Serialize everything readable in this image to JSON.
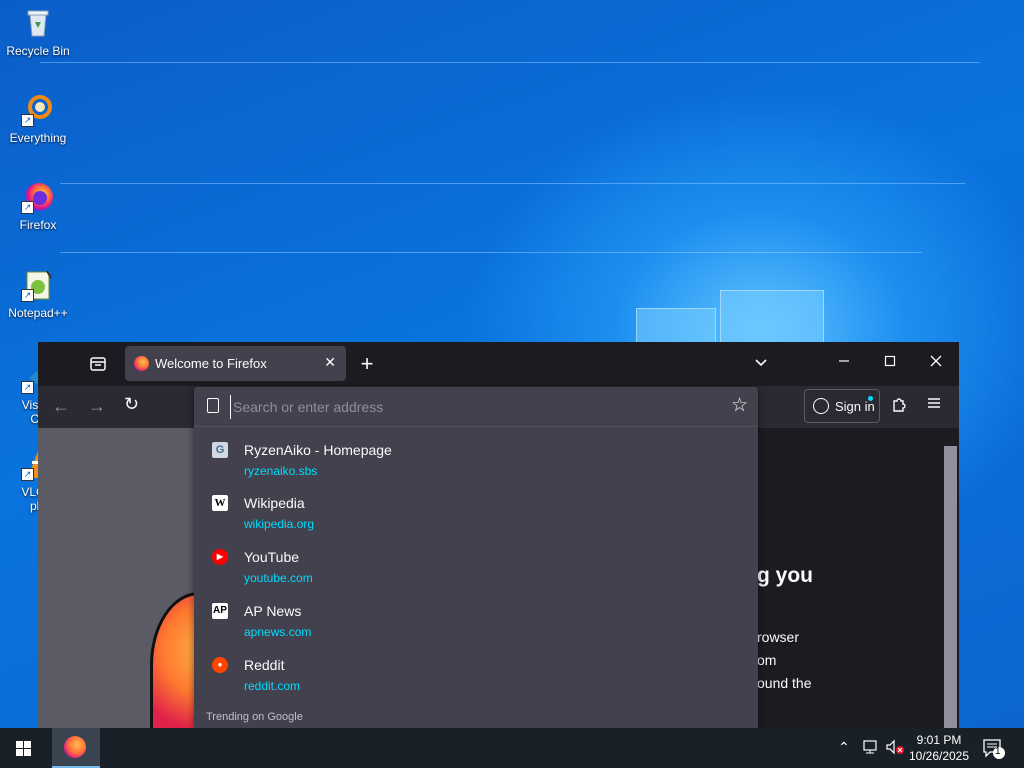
{
  "desktop": {
    "icons": [
      {
        "label": "Recycle Bin"
      },
      {
        "label": "Everything"
      },
      {
        "label": "Firefox"
      },
      {
        "label": "Notepad++"
      },
      {
        "label_line1": "Visual",
        "label_line2": "Co"
      },
      {
        "label_line1": "VLC n",
        "label_line2": "pla"
      }
    ]
  },
  "browser": {
    "tab_title": "Welcome to Firefox",
    "sign_in_label": "Sign in",
    "address": {
      "value": "",
      "placeholder": "Search or enter address"
    },
    "suggestions": [
      {
        "name": "RyzenAiko - Homepage",
        "url": "ryzenaiko.sbs",
        "favicon": "G"
      },
      {
        "name": "Wikipedia",
        "url": "wikipedia.org",
        "favicon": "W"
      },
      {
        "name": "YouTube",
        "url": "youtube.com",
        "favicon": "▶"
      },
      {
        "name": "AP News",
        "url": "apnews.com",
        "favicon": "AP"
      },
      {
        "name": "Reddit",
        "url": "reddit.com",
        "favicon": "●"
      }
    ],
    "trending_label": "Trending on Google",
    "page_fragments": {
      "heading": "g you",
      "line1": "rowser",
      "line2": "om",
      "line3": "ound the"
    }
  },
  "taskbar": {
    "time": "9:01 PM",
    "date": "10/26/2025",
    "notification_count": "1"
  },
  "colors": {
    "accent": "#00ddff",
    "firefox_dark": "#1c1b22",
    "panel": "#42414d"
  }
}
